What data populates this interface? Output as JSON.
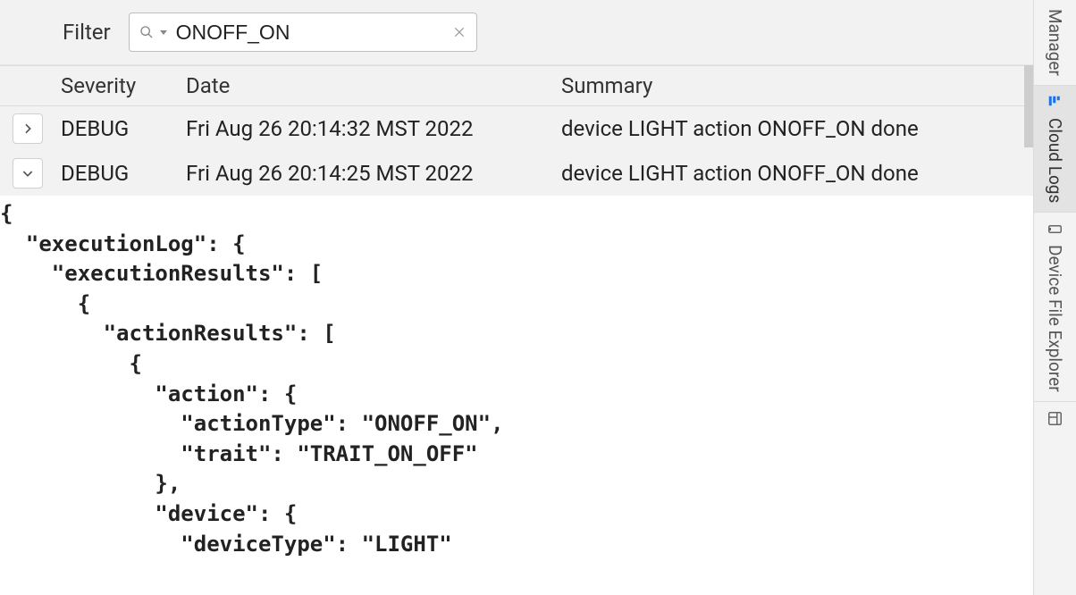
{
  "filter": {
    "label": "Filter",
    "value": "ONOFF_ON"
  },
  "columns": {
    "severity": "Severity",
    "date": "Date",
    "summary": "Summary"
  },
  "rows": [
    {
      "severity": "DEBUG",
      "date": "Fri Aug 26 20:14:32 MST 2022",
      "summary": "device LIGHT action ONOFF_ON done",
      "expanded": false
    },
    {
      "severity": "DEBUG",
      "date": "Fri Aug 26 20:14:25 MST 2022",
      "summary": "device LIGHT action ONOFF_ON done",
      "expanded": true
    }
  ],
  "json_preview": "{\n  \"executionLog\": {\n    \"executionResults\": [\n      {\n        \"actionResults\": [\n          {\n            \"action\": {\n              \"actionType\": \"ONOFF_ON\",\n              \"trait\": \"TRAIT_ON_OFF\"\n            },\n            \"device\": {\n              \"deviceType\": \"LIGHT\"",
  "side_panels": {
    "manager": "Manager",
    "cloud_logs": "Cloud Logs",
    "device_file_explorer": "Device File Explorer"
  },
  "colors": {
    "accent_icon": "#1a73e8"
  }
}
